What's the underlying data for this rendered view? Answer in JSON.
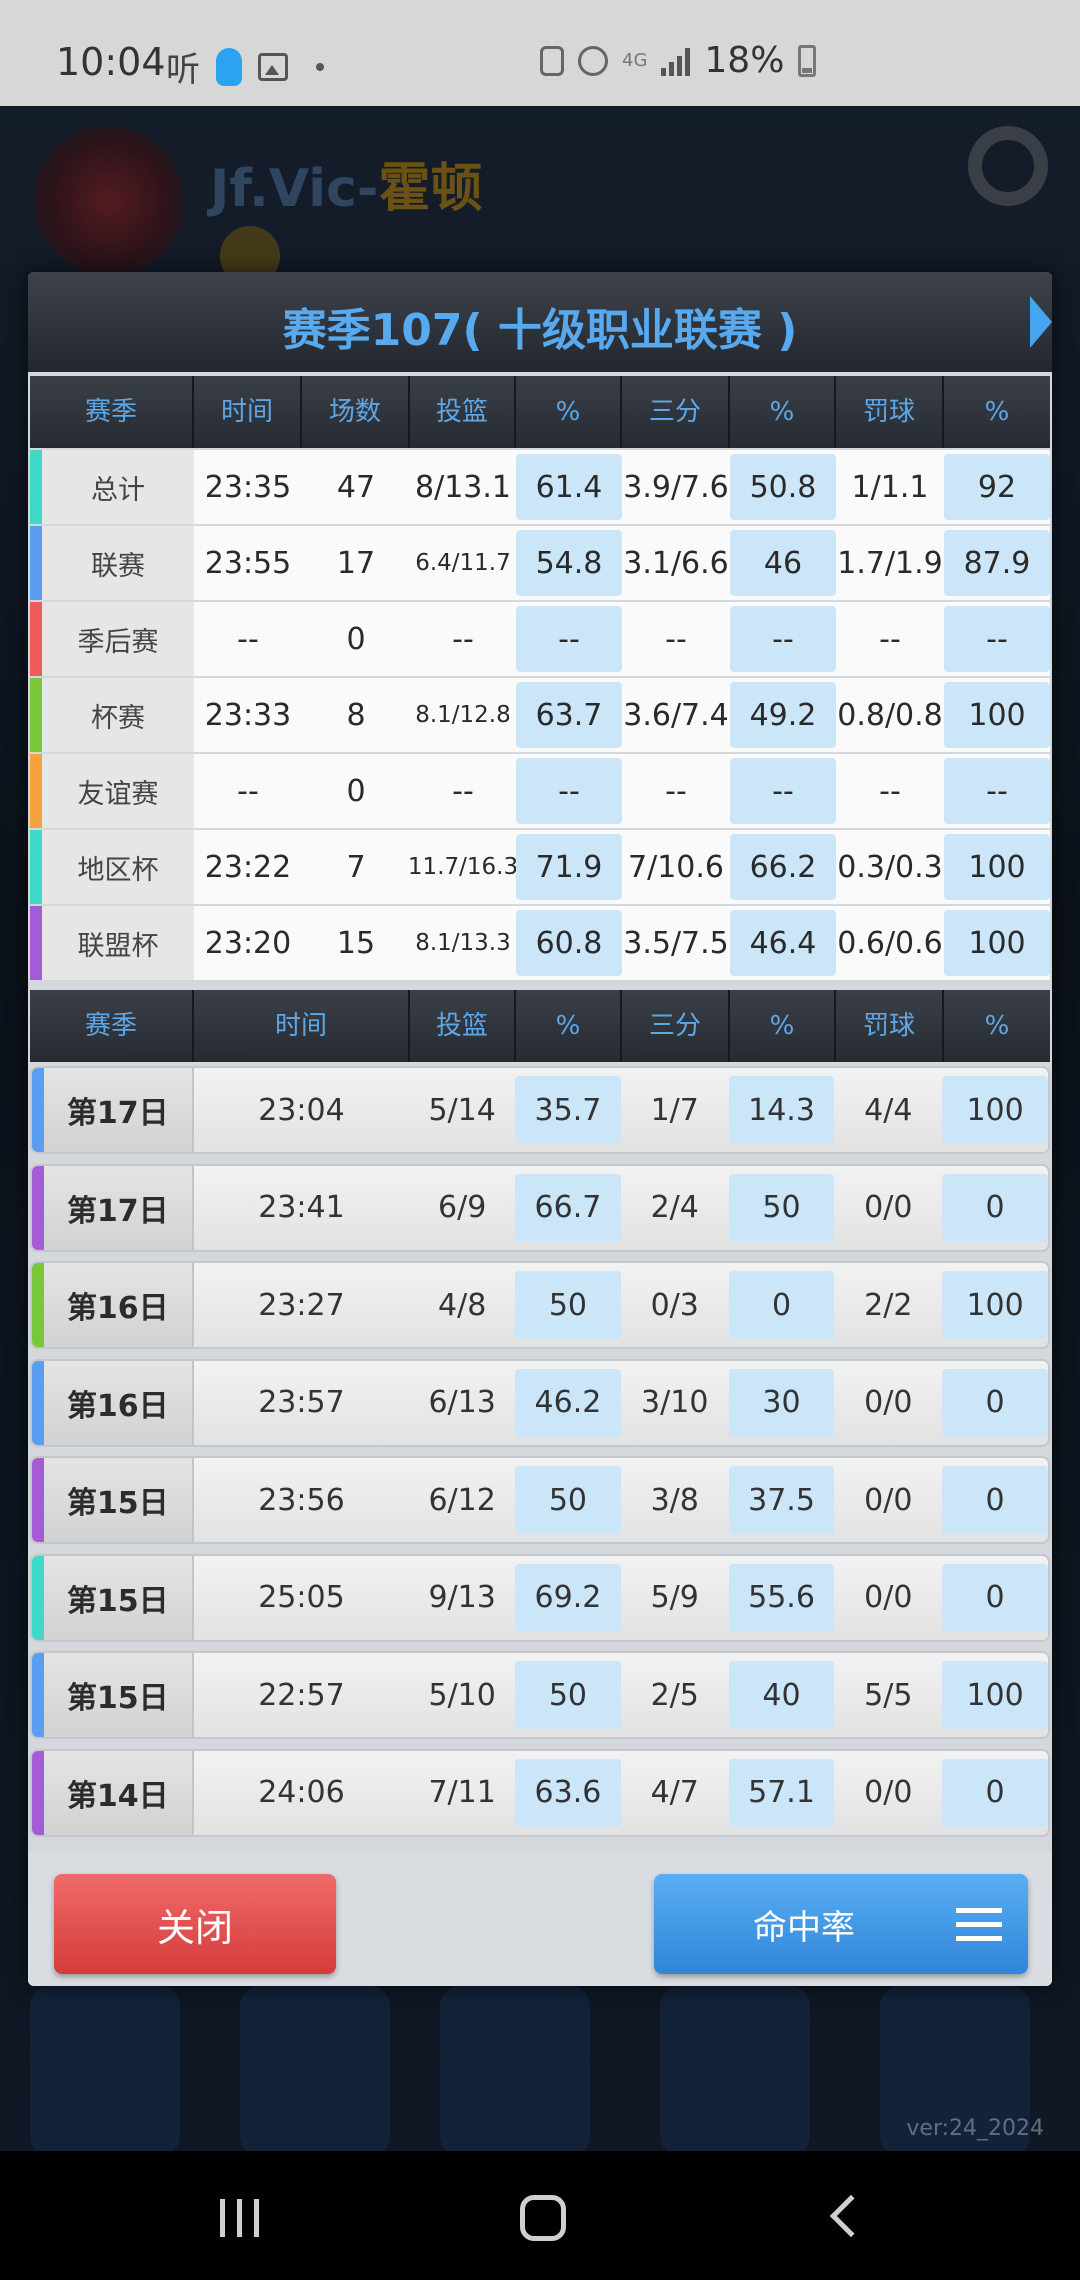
{
  "status_bar": {
    "time": "10:04",
    "listen_label": "听",
    "network": "4G",
    "battery": "18%"
  },
  "background": {
    "player_name": "Jf.Vic-",
    "player_suffix": "霍顿",
    "version": "ver:24_2024"
  },
  "dialog": {
    "title": "赛季107( 十级职业联赛 )",
    "season_headers": [
      "赛季",
      "时间",
      "场数",
      "投篮",
      "%",
      "三分",
      "%",
      "罚球",
      "%"
    ],
    "season_rows": [
      {
        "label": "总计",
        "color": "#3fd9c8",
        "cells": [
          "23:35",
          "47",
          "8/13.1",
          "61.4",
          "3.9/7.6",
          "50.8",
          "1/1.1",
          "92"
        ]
      },
      {
        "label": "联赛",
        "color": "#5a9ef0",
        "cells": [
          "23:55",
          "17",
          "6.4/11.7",
          "54.8",
          "3.1/6.6",
          "46",
          "1.7/1.9",
          "87.9"
        ]
      },
      {
        "label": "季后赛",
        "color": "#f05a5a",
        "cells": [
          "--",
          "0",
          "--",
          "--",
          "--",
          "--",
          "--",
          "--"
        ]
      },
      {
        "label": "杯赛",
        "color": "#79c83a",
        "cells": [
          "23:33",
          "8",
          "8.1/12.8",
          "63.7",
          "3.6/7.4",
          "49.2",
          "0.8/0.8",
          "100"
        ]
      },
      {
        "label": "友谊赛",
        "color": "#f5a33a",
        "cells": [
          "--",
          "0",
          "--",
          "--",
          "--",
          "--",
          "--",
          "--"
        ]
      },
      {
        "label": "地区杯",
        "color": "#3fd9c8",
        "cells": [
          "23:22",
          "7",
          "11.7/16.3",
          "71.9",
          "7/10.6",
          "66.2",
          "0.3/0.3",
          "100"
        ]
      },
      {
        "label": "联盟杯",
        "color": "#a55ad6",
        "cells": [
          "23:20",
          "15",
          "8.1/13.3",
          "60.8",
          "3.5/7.5",
          "46.4",
          "0.6/0.6",
          "100"
        ]
      }
    ],
    "game_headers": [
      "赛季",
      "时间",
      "投篮",
      "%",
      "三分",
      "%",
      "罚球",
      "%"
    ],
    "game_rows": [
      {
        "day": "第17日",
        "color": "#5a9ef0",
        "cells": [
          "23:04",
          "5/14",
          "35.7",
          "1/7",
          "14.3",
          "4/4",
          "100"
        ]
      },
      {
        "day": "第17日",
        "color": "#a55ad6",
        "cells": [
          "23:41",
          "6/9",
          "66.7",
          "2/4",
          "50",
          "0/0",
          "0"
        ]
      },
      {
        "day": "第16日",
        "color": "#79c83a",
        "cells": [
          "23:27",
          "4/8",
          "50",
          "0/3",
          "0",
          "2/2",
          "100"
        ]
      },
      {
        "day": "第16日",
        "color": "#5a9ef0",
        "cells": [
          "23:57",
          "6/13",
          "46.2",
          "3/10",
          "30",
          "0/0",
          "0"
        ]
      },
      {
        "day": "第15日",
        "color": "#a55ad6",
        "cells": [
          "23:56",
          "6/12",
          "50",
          "3/8",
          "37.5",
          "0/0",
          "0"
        ]
      },
      {
        "day": "第15日",
        "color": "#3fd9c8",
        "cells": [
          "25:05",
          "9/13",
          "69.2",
          "5/9",
          "55.6",
          "0/0",
          "0"
        ]
      },
      {
        "day": "第15日",
        "color": "#5a9ef0",
        "cells": [
          "22:57",
          "5/10",
          "50",
          "2/5",
          "40",
          "5/5",
          "100"
        ]
      },
      {
        "day": "第14日",
        "color": "#a55ad6",
        "cells": [
          "24:06",
          "7/11",
          "63.6",
          "4/7",
          "57.1",
          "0/0",
          "0"
        ]
      }
    ],
    "close_label": "关闭",
    "rate_label": "命中率"
  }
}
